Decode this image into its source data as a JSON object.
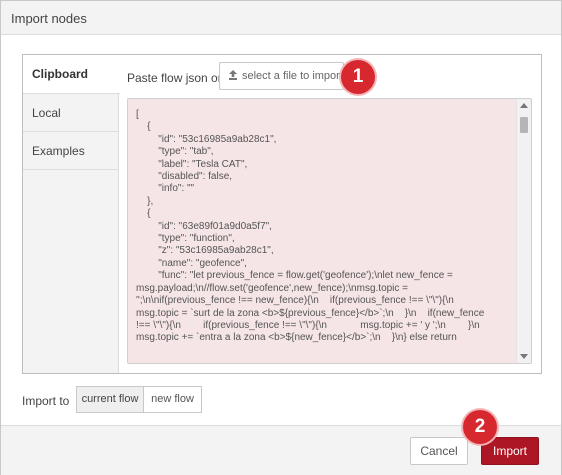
{
  "dialog": {
    "title": "Import nodes"
  },
  "tabs": [
    {
      "label": "Clipboard",
      "active": true
    },
    {
      "label": "Local",
      "active": false
    },
    {
      "label": "Examples",
      "active": false
    }
  ],
  "clipboard": {
    "paste_label": "Paste flow json or",
    "file_button_label": "select a file to import",
    "file_button_icon": "upload-icon",
    "code_lines": [
      "[",
      "    {",
      "        \"id\": \"53c16985a9ab28c1\",",
      "        \"type\": \"tab\",",
      "        \"label\": \"Tesla CAT\",",
      "        \"disabled\": false,",
      "        \"info\": \"\"",
      "    },",
      "    {",
      "        \"id\": \"63e89f01a9d0a5f7\",",
      "        \"type\": \"function\",",
      "        \"z\": \"53c16985a9ab28c1\",",
      "        \"name\": \"geofence\",",
      "        \"func\": \"let previous_fence = flow.get('geofence');\\nlet new_fence =",
      "msg.payload;\\n//flow.set('geofence',new_fence);\\nmsg.topic =",
      "'';\\n\\nif(previous_fence !== new_fence){\\n    if(previous_fence !== \\\"\\\"){\\n",
      "msg.topic = `surt de la zona <b>${previous_fence}</b>`;\\n    }\\n    if(new_fence",
      "!== \\\"\\\"){\\n        if(previous_fence !== \\\"\\\"){\\n            msg.topic += ' y ';\\n        }\\n",
      "msg.topic += `entra a la zona <b>${new_fence}</b>`;\\n    }\\n} else return"
    ]
  },
  "import_to": {
    "label": "Import to",
    "options": [
      {
        "label": "current flow",
        "selected": true
      },
      {
        "label": "new flow",
        "selected": false
      }
    ]
  },
  "footer": {
    "cancel_label": "Cancel",
    "import_label": "Import"
  },
  "badges": {
    "first": "1",
    "second": "2"
  },
  "colors": {
    "accent": "#ad1625",
    "badge": "#d7282f",
    "editor_bg": "#f6e5e6"
  }
}
